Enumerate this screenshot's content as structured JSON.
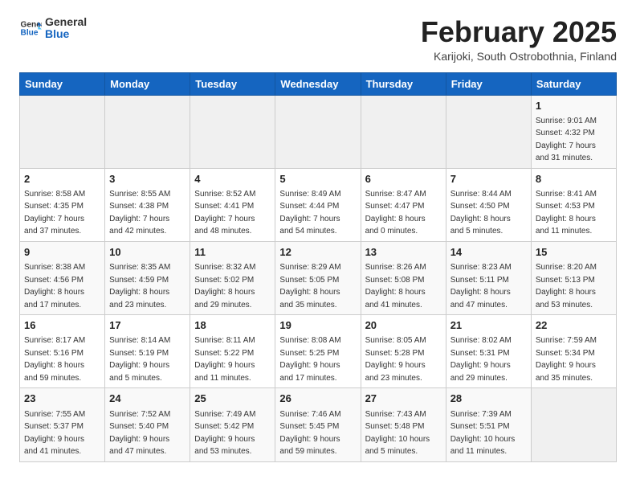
{
  "logo": {
    "general": "General",
    "blue": "Blue"
  },
  "title": "February 2025",
  "subtitle": "Karijoki, South Ostrobothnia, Finland",
  "days_of_week": [
    "Sunday",
    "Monday",
    "Tuesday",
    "Wednesday",
    "Thursday",
    "Friday",
    "Saturday"
  ],
  "weeks": [
    [
      {
        "day": "",
        "info": ""
      },
      {
        "day": "",
        "info": ""
      },
      {
        "day": "",
        "info": ""
      },
      {
        "day": "",
        "info": ""
      },
      {
        "day": "",
        "info": ""
      },
      {
        "day": "",
        "info": ""
      },
      {
        "day": "1",
        "info": "Sunrise: 9:01 AM\nSunset: 4:32 PM\nDaylight: 7 hours\nand 31 minutes."
      }
    ],
    [
      {
        "day": "2",
        "info": "Sunrise: 8:58 AM\nSunset: 4:35 PM\nDaylight: 7 hours\nand 37 minutes."
      },
      {
        "day": "3",
        "info": "Sunrise: 8:55 AM\nSunset: 4:38 PM\nDaylight: 7 hours\nand 42 minutes."
      },
      {
        "day": "4",
        "info": "Sunrise: 8:52 AM\nSunset: 4:41 PM\nDaylight: 7 hours\nand 48 minutes."
      },
      {
        "day": "5",
        "info": "Sunrise: 8:49 AM\nSunset: 4:44 PM\nDaylight: 7 hours\nand 54 minutes."
      },
      {
        "day": "6",
        "info": "Sunrise: 8:47 AM\nSunset: 4:47 PM\nDaylight: 8 hours\nand 0 minutes."
      },
      {
        "day": "7",
        "info": "Sunrise: 8:44 AM\nSunset: 4:50 PM\nDaylight: 8 hours\nand 5 minutes."
      },
      {
        "day": "8",
        "info": "Sunrise: 8:41 AM\nSunset: 4:53 PM\nDaylight: 8 hours\nand 11 minutes."
      }
    ],
    [
      {
        "day": "9",
        "info": "Sunrise: 8:38 AM\nSunset: 4:56 PM\nDaylight: 8 hours\nand 17 minutes."
      },
      {
        "day": "10",
        "info": "Sunrise: 8:35 AM\nSunset: 4:59 PM\nDaylight: 8 hours\nand 23 minutes."
      },
      {
        "day": "11",
        "info": "Sunrise: 8:32 AM\nSunset: 5:02 PM\nDaylight: 8 hours\nand 29 minutes."
      },
      {
        "day": "12",
        "info": "Sunrise: 8:29 AM\nSunset: 5:05 PM\nDaylight: 8 hours\nand 35 minutes."
      },
      {
        "day": "13",
        "info": "Sunrise: 8:26 AM\nSunset: 5:08 PM\nDaylight: 8 hours\nand 41 minutes."
      },
      {
        "day": "14",
        "info": "Sunrise: 8:23 AM\nSunset: 5:11 PM\nDaylight: 8 hours\nand 47 minutes."
      },
      {
        "day": "15",
        "info": "Sunrise: 8:20 AM\nSunset: 5:13 PM\nDaylight: 8 hours\nand 53 minutes."
      }
    ],
    [
      {
        "day": "16",
        "info": "Sunrise: 8:17 AM\nSunset: 5:16 PM\nDaylight: 8 hours\nand 59 minutes."
      },
      {
        "day": "17",
        "info": "Sunrise: 8:14 AM\nSunset: 5:19 PM\nDaylight: 9 hours\nand 5 minutes."
      },
      {
        "day": "18",
        "info": "Sunrise: 8:11 AM\nSunset: 5:22 PM\nDaylight: 9 hours\nand 11 minutes."
      },
      {
        "day": "19",
        "info": "Sunrise: 8:08 AM\nSunset: 5:25 PM\nDaylight: 9 hours\nand 17 minutes."
      },
      {
        "day": "20",
        "info": "Sunrise: 8:05 AM\nSunset: 5:28 PM\nDaylight: 9 hours\nand 23 minutes."
      },
      {
        "day": "21",
        "info": "Sunrise: 8:02 AM\nSunset: 5:31 PM\nDaylight: 9 hours\nand 29 minutes."
      },
      {
        "day": "22",
        "info": "Sunrise: 7:59 AM\nSunset: 5:34 PM\nDaylight: 9 hours\nand 35 minutes."
      }
    ],
    [
      {
        "day": "23",
        "info": "Sunrise: 7:55 AM\nSunset: 5:37 PM\nDaylight: 9 hours\nand 41 minutes."
      },
      {
        "day": "24",
        "info": "Sunrise: 7:52 AM\nSunset: 5:40 PM\nDaylight: 9 hours\nand 47 minutes."
      },
      {
        "day": "25",
        "info": "Sunrise: 7:49 AM\nSunset: 5:42 PM\nDaylight: 9 hours\nand 53 minutes."
      },
      {
        "day": "26",
        "info": "Sunrise: 7:46 AM\nSunset: 5:45 PM\nDaylight: 9 hours\nand 59 minutes."
      },
      {
        "day": "27",
        "info": "Sunrise: 7:43 AM\nSunset: 5:48 PM\nDaylight: 10 hours\nand 5 minutes."
      },
      {
        "day": "28",
        "info": "Sunrise: 7:39 AM\nSunset: 5:51 PM\nDaylight: 10 hours\nand 11 minutes."
      },
      {
        "day": "",
        "info": ""
      }
    ]
  ]
}
